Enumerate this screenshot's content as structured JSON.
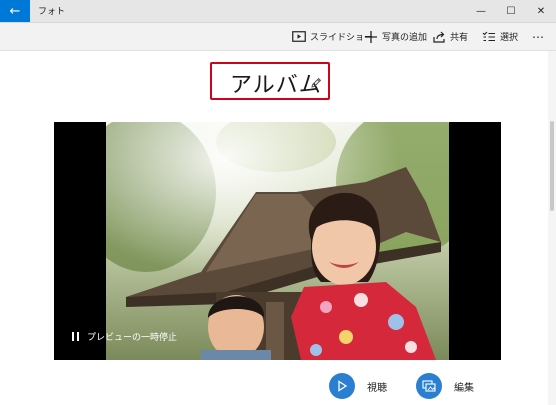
{
  "window": {
    "app_title": "フォト",
    "back_icon": "back-arrow-icon",
    "controls": [
      "minimize-icon",
      "maximize-icon",
      "close-icon"
    ]
  },
  "toolbar": {
    "slideshow_label": "スライドショー",
    "add_photos_label": "写真の追加",
    "share_label": "共有",
    "select_label": "選択",
    "more_label": "⋯"
  },
  "album": {
    "title": "アルバム"
  },
  "preview": {
    "pause_label": "プレビューの一時停止"
  },
  "actions": {
    "watch_label": "視聴",
    "edit_label": "編集"
  },
  "colors": {
    "accent": "#0078d7",
    "button_blue": "#2a7fd0",
    "title_box_border": "#d0021b"
  }
}
